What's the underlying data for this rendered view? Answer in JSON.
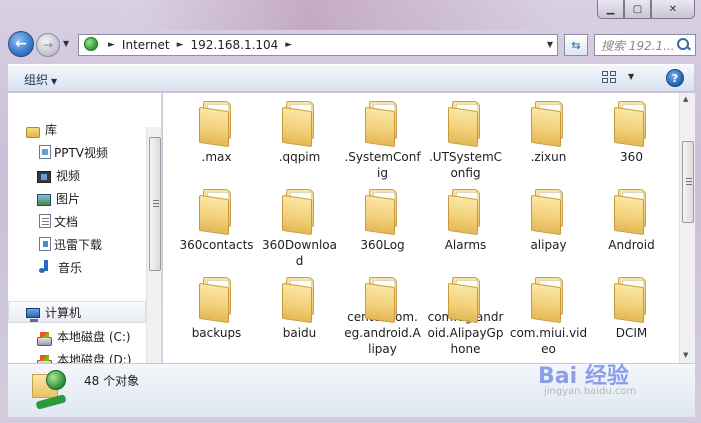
{
  "window": {
    "caption": {
      "min": "▁",
      "max": "▢",
      "close": "✕"
    }
  },
  "address_bar": {
    "segments": [
      "Internet",
      "192.168.1.104"
    ],
    "search_placeholder": "搜索 192.1..."
  },
  "toolbar": {
    "organize_label": "组织"
  },
  "nav_pane": {
    "library": "库",
    "items": [
      "PPTV视频",
      "视频",
      "图片",
      "文档",
      "迅雷下载",
      "音乐"
    ],
    "computer": "计算机",
    "drives": [
      "本地磁盘 (C:)",
      "本地磁盘 (D:)"
    ]
  },
  "folders": [
    ".max",
    ".qqpim",
    ".SystemConfig",
    ".UTSystemConfig",
    ".zixun",
    "360",
    "360contacts",
    "360Download",
    "360Log",
    "Alarms",
    "alipay",
    "Android",
    "backups",
    "baidu",
    "center.com.eg.android.Alipay",
    "com.eg.android.AlipayGphone",
    "com.miui.video",
    "DCIM"
  ],
  "details": {
    "count_text": "48 个对象"
  },
  "watermark": {
    "text": "Bai 经验",
    "sub": "jingyan.baidu.com"
  }
}
